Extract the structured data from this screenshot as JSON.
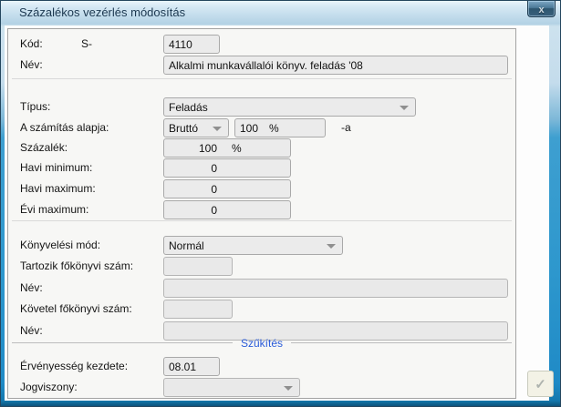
{
  "window": {
    "title": "Százalékos vezérlés módosítás",
    "close_glyph": "x"
  },
  "colors": {
    "frame_blue": "#2d97cd",
    "panel_bg": "#f7f7f5",
    "link_blue": "#2b5cd9"
  },
  "form": {
    "kod": {
      "label": "Kód:",
      "prefix": "S-",
      "value": "4110"
    },
    "nev1": {
      "label": "Név:",
      "value": "Alkalmi munkavállalói könyv. feladás '08"
    },
    "tipus": {
      "label": "Típus:",
      "value": "Feladás"
    },
    "szamitas": {
      "label": "A számítás alapja:",
      "base": "Bruttó",
      "percent": "100",
      "unit": "%",
      "suffix": "-a"
    },
    "szazalek": {
      "label": "Százalék:",
      "value": "100",
      "unit": "%"
    },
    "havi_min": {
      "label": "Havi minimum:",
      "value": "0"
    },
    "havi_max": {
      "label": "Havi maximum:",
      "value": "0"
    },
    "evi_max": {
      "label": "Évi maximum:",
      "value": "0"
    },
    "konyvelesi_mod": {
      "label": "Könyvelési mód:",
      "value": "Normál"
    },
    "tartozik_szam": {
      "label": "Tartozik főkönyvi szám:",
      "value": ""
    },
    "nev2": {
      "label": "Név:",
      "value": ""
    },
    "kovetel_szam": {
      "label": "Követel főkönyvi szám:",
      "value": ""
    },
    "nev3": {
      "label": "Név:",
      "value": ""
    },
    "szukites": {
      "label": "Szűkítés"
    },
    "ervenyesseg": {
      "label": "Érvényesség kezdete:",
      "value": "08.01"
    },
    "jogviszony": {
      "label": "Jogviszony:",
      "value": ""
    }
  },
  "footer": {
    "confirm_glyph": "✓"
  }
}
